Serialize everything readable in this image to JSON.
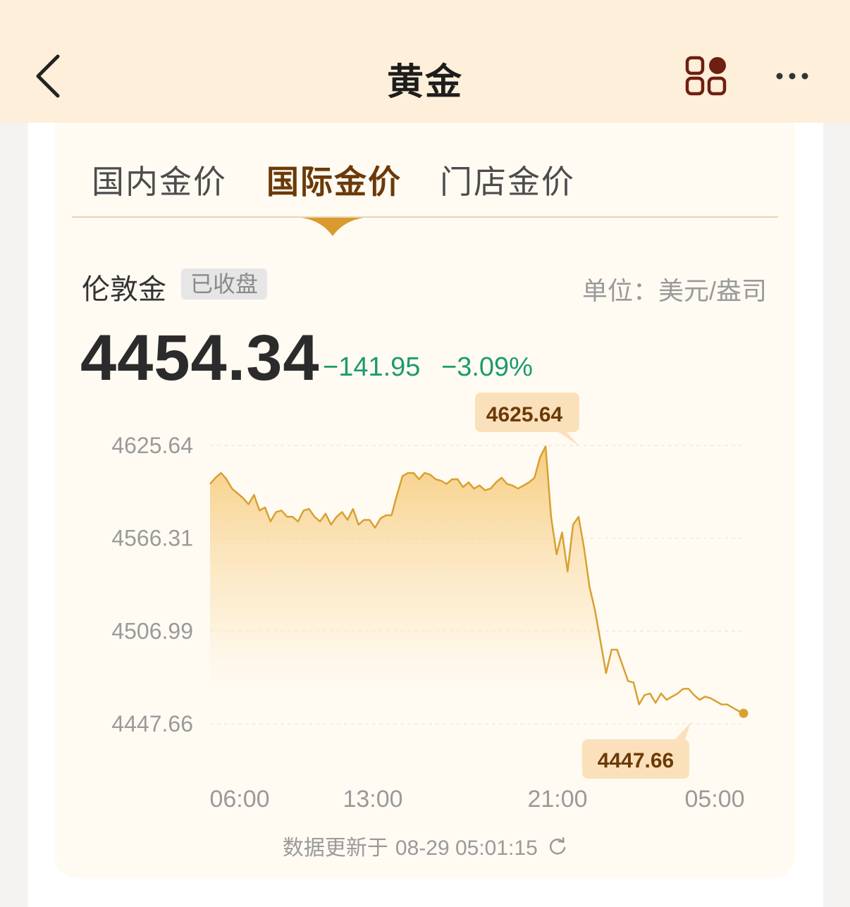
{
  "header": {
    "title": "黄金"
  },
  "tabs": [
    {
      "label": "国内金价",
      "active": false
    },
    {
      "label": "国际金价",
      "active": true
    },
    {
      "label": "门店金价",
      "active": false
    }
  ],
  "quote": {
    "instrument": "伦敦金",
    "status": "已收盘",
    "unit": "单位：美元/盎司",
    "price": "4454.34",
    "change": "−141.95",
    "change_pct": "−3.09%",
    "high_tooltip": "4625.64",
    "low_tooltip": "4447.66",
    "update_label": "数据更新于",
    "update_time": "08-29 05:01:15"
  },
  "colors": {
    "down": "#1e9a6e",
    "line": "#d9a032",
    "accent": "#6b3a08"
  },
  "chart_data": {
    "type": "area",
    "x_tick_labels": [
      "06:00",
      "13:00",
      "21:00",
      "05:00"
    ],
    "y_tick_labels": [
      "4625.64",
      "4566.31",
      "4506.99",
      "4447.66"
    ],
    "ylim": [
      4447.66,
      4625.64
    ],
    "grid": true,
    "series": [
      {
        "values": [
          4601,
          4605,
          4608,
          4604,
          4598,
          4595,
          4592,
          4588,
          4594,
          4584,
          4586,
          4577,
          4583,
          4584,
          4580,
          4580,
          4577,
          4584,
          4585,
          4580,
          4577,
          4582,
          4575,
          4580,
          4583,
          4578,
          4585,
          4575,
          4578,
          4578,
          4573,
          4579,
          4581,
          4581,
          4594,
          4606,
          4608,
          4608,
          4604,
          4608,
          4607,
          4604,
          4603,
          4601,
          4604,
          4604,
          4599,
          4602,
          4598,
          4600,
          4597,
          4598,
          4602,
          4605,
          4601,
          4600,
          4598,
          4600,
          4602,
          4605,
          4618,
          4625,
          4580,
          4556,
          4570,
          4545,
          4575,
          4580,
          4560,
          4535,
          4520,
          4500,
          4480,
          4495,
          4495,
          4485,
          4475,
          4474,
          4460,
          4466,
          4467,
          4461,
          4467,
          4463,
          4465,
          4467,
          4470,
          4470,
          4466,
          4463,
          4465,
          4464,
          4462,
          4460,
          4460,
          4458,
          4456,
          4454.34
        ]
      }
    ]
  }
}
